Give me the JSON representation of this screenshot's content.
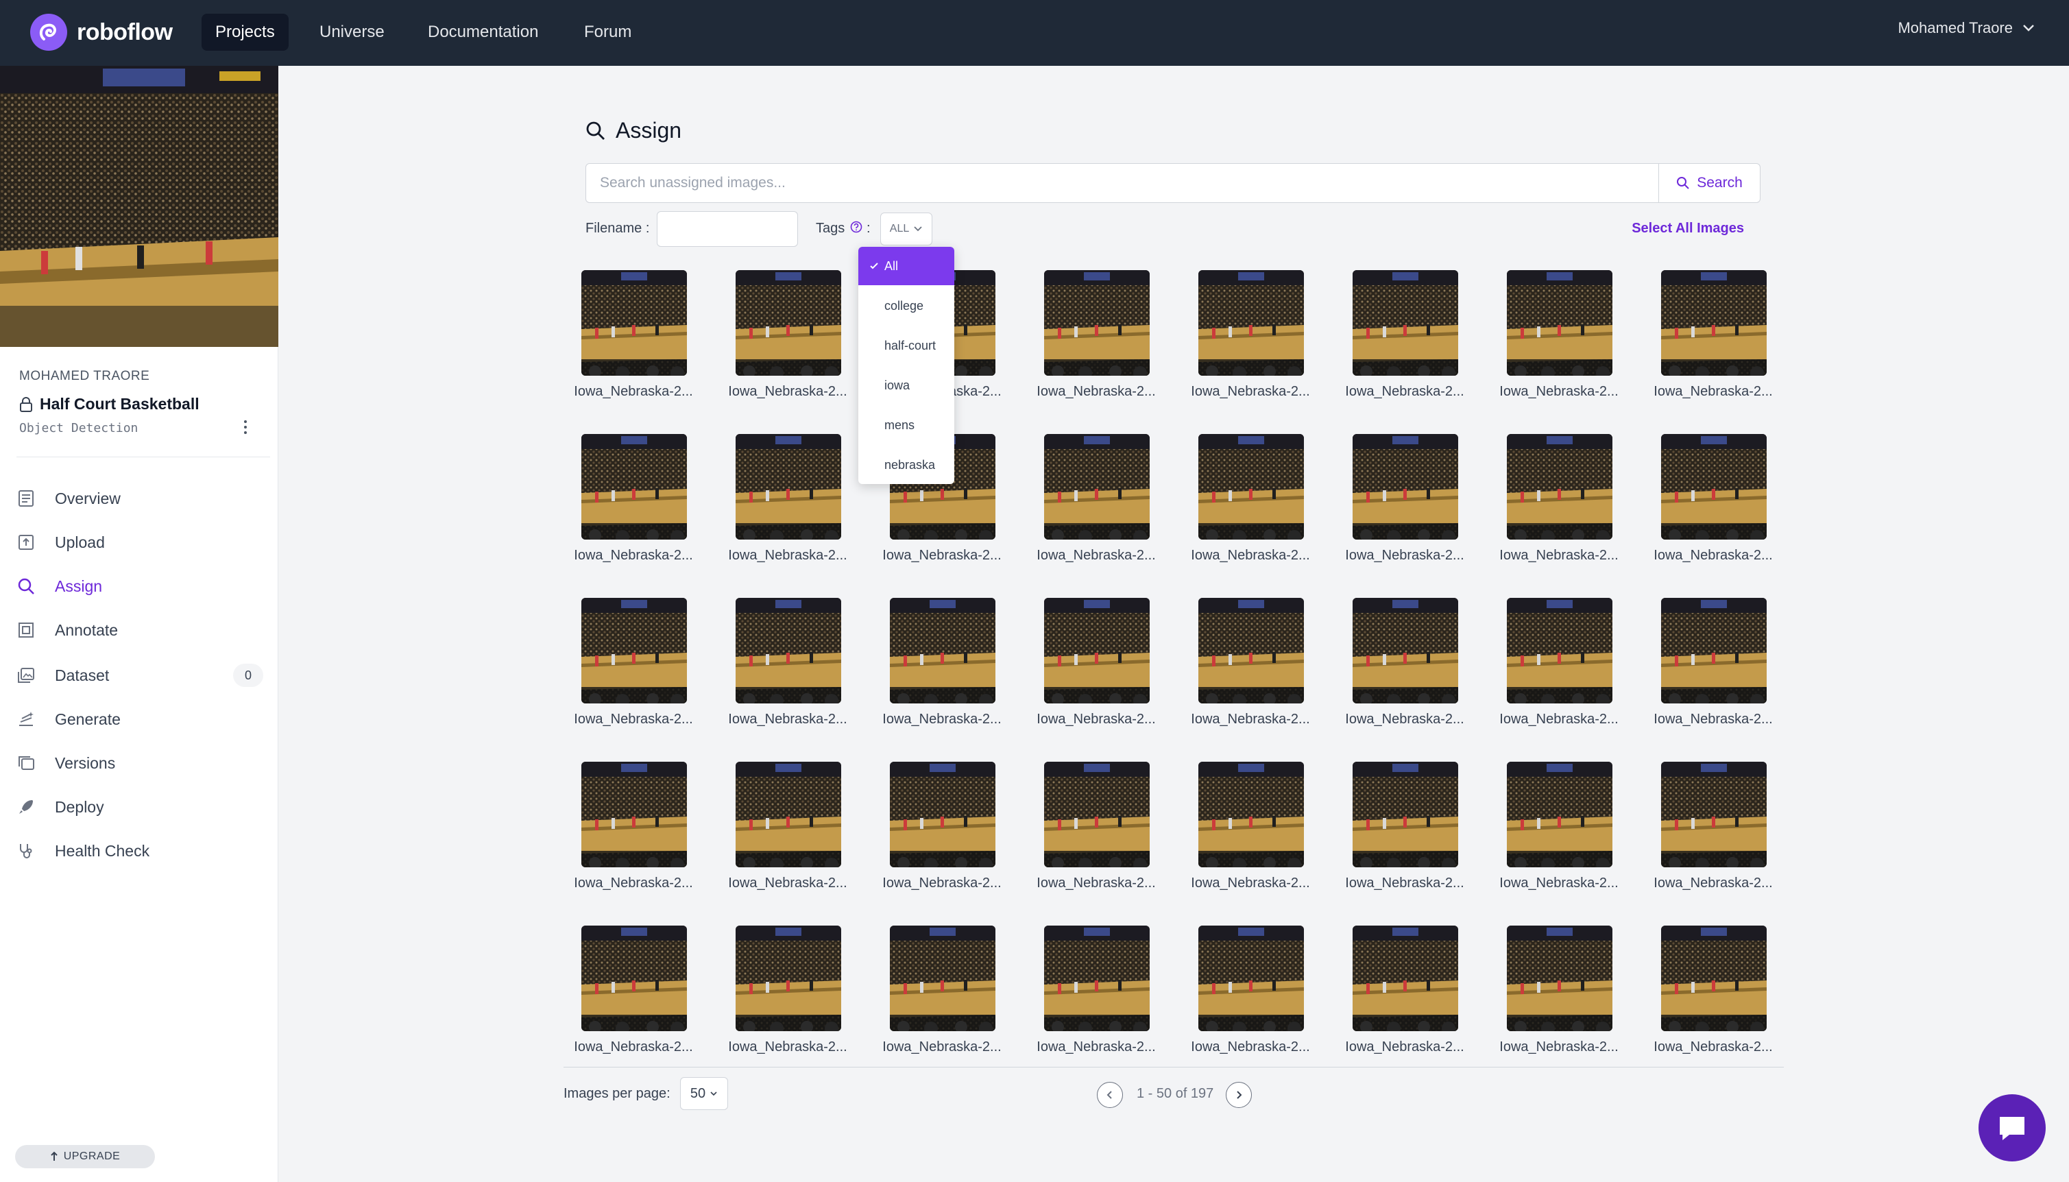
{
  "brand": {
    "name": "roboflow",
    "accent": "#6d28d9",
    "nav_bg": "#1f2937"
  },
  "topnav": {
    "items": [
      {
        "label": "Projects",
        "active": true
      },
      {
        "label": "Universe"
      },
      {
        "label": "Documentation"
      },
      {
        "label": "Forum"
      }
    ],
    "user": "Mohamed Traore"
  },
  "sidebar": {
    "owner": "MOHAMED TRAORE",
    "project_name": "Half Court Basketball",
    "project_type": "Object Detection",
    "items": [
      {
        "label": "Overview",
        "icon": "overview-icon"
      },
      {
        "label": "Upload",
        "icon": "upload-icon"
      },
      {
        "label": "Assign",
        "icon": "search-icon",
        "active": true
      },
      {
        "label": "Annotate",
        "icon": "annotate-icon"
      },
      {
        "label": "Dataset",
        "icon": "dataset-icon",
        "badge": "0"
      },
      {
        "label": "Generate",
        "icon": "generate-icon"
      },
      {
        "label": "Versions",
        "icon": "versions-icon"
      },
      {
        "label": "Deploy",
        "icon": "rocket-icon"
      },
      {
        "label": "Health Check",
        "icon": "stethoscope-icon"
      }
    ],
    "upgrade_label": "UPGRADE"
  },
  "main": {
    "title": "Assign",
    "search_placeholder": "Search unassigned images...",
    "search_button": "Search",
    "filename_label": "Filename :",
    "filename_value": "",
    "tags_label": "Tags",
    "tags_colon": ":",
    "tags_selected": "ALL",
    "select_all": "Select All Images",
    "images": [
      "Iowa_Nebraska-2...",
      "Iowa_Nebraska-2...",
      "Iowa_Nebraska-2...",
      "Iowa_Nebraska-2...",
      "Iowa_Nebraska-2...",
      "Iowa_Nebraska-2...",
      "Iowa_Nebraska-2...",
      "Iowa_Nebraska-2...",
      "Iowa_Nebraska-2...",
      "Iowa_Nebraska-2...",
      "Iowa_Nebraska-2...",
      "Iowa_Nebraska-2...",
      "Iowa_Nebraska-2...",
      "Iowa_Nebraska-2...",
      "Iowa_Nebraska-2...",
      "Iowa_Nebraska-2...",
      "Iowa_Nebraska-2...",
      "Iowa_Nebraska-2...",
      "Iowa_Nebraska-2...",
      "Iowa_Nebraska-2...",
      "Iowa_Nebraska-2...",
      "Iowa_Nebraska-2...",
      "Iowa_Nebraska-2...",
      "Iowa_Nebraska-2...",
      "Iowa_Nebraska-2...",
      "Iowa_Nebraska-2...",
      "Iowa_Nebraska-2...",
      "Iowa_Nebraska-2...",
      "Iowa_Nebraska-2...",
      "Iowa_Nebraska-2...",
      "Iowa_Nebraska-2...",
      "Iowa_Nebraska-2...",
      "Iowa_Nebraska-2...",
      "Iowa_Nebraska-2...",
      "Iowa_Nebraska-2...",
      "Iowa_Nebraska-2...",
      "Iowa_Nebraska-2...",
      "Iowa_Nebraska-2...",
      "Iowa_Nebraska-2...",
      "Iowa_Nebraska-2..."
    ],
    "grid_columns": 8,
    "per_page_label": "Images per page:",
    "per_page_value": "50",
    "pagination": "1 - 50 of 197"
  },
  "tags_dropdown": {
    "options": [
      {
        "label": "All",
        "selected": true
      },
      {
        "label": "college"
      },
      {
        "label": "half-court"
      },
      {
        "label": "iowa"
      },
      {
        "label": "mens"
      },
      {
        "label": "nebraska"
      }
    ]
  }
}
